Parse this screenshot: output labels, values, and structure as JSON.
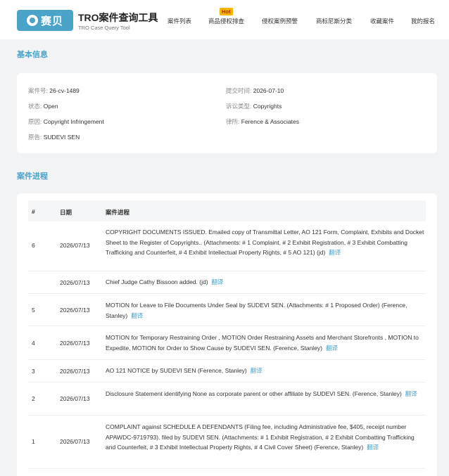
{
  "header": {
    "logo_text": "赛贝",
    "app_title": "TRO案件查询工具",
    "app_subtitle": "TRO Case Query Tool",
    "hot_badge": "Hot",
    "nav": [
      {
        "label": "案件列表"
      },
      {
        "label": "商品侵权排查"
      },
      {
        "label": "侵权案例预警"
      },
      {
        "label": "商标尼斯分类"
      },
      {
        "label": "收藏案件"
      },
      {
        "label": "我的报名"
      }
    ]
  },
  "basic_info": {
    "title": "基本信息",
    "fields": [
      {
        "label": "案件号:",
        "value": "26-cv-1489"
      },
      {
        "label": "提交时间:",
        "value": "2026-07-10"
      },
      {
        "label": "状态:",
        "value": "Open"
      },
      {
        "label": "诉讼类型:",
        "value": "Copyrights"
      },
      {
        "label": "原因:",
        "value": "Copyright Infringement"
      },
      {
        "label": "律所:",
        "value": "Ference & Associates"
      },
      {
        "label": "原告:",
        "value": "SUDEVI SEN"
      }
    ]
  },
  "progress": {
    "title": "案件进程",
    "columns": [
      "#",
      "日期",
      "案件进程"
    ],
    "translate_label": "翻译",
    "rows": [
      {
        "num": "6",
        "date": "2026/07/13",
        "text": "COPYRIGHT DOCUMENTS ISSUED. Emailed copy of Transmittal Letter, AO 121 Form, Complaint, Exhibits and Docket Sheet to the Register of Copyrights.. (Attachments: # 1 Complaint, # 2 Exhibit Registration, # 3 Exhibit Combatting Trafficking and Counterfeit, # 4 Exhibit Intellectual Property Rights, # 5 AO 121) (jd)"
      },
      {
        "num": "",
        "date": "2026/07/13",
        "text": "Chief Judge Cathy Bissoon added. (jd)"
      },
      {
        "num": "5",
        "date": "2026/07/13",
        "text": "MOTION for Leave to File Documents Under Seal by SUDEVI SEN. (Attachments: # 1 Proposed Order) (Ference, Stanley)"
      },
      {
        "num": "4",
        "date": "2026/07/13",
        "text": "MOTION for Temporary Restraining Order , MOTION Order Restraining Assets and Merchant Storefronts , MOTION to Expedite, MOTION for Order to Show Cause by SUDEVI SEN. (Ference, Stanley)"
      },
      {
        "num": "3",
        "date": "2026/07/13",
        "text": "AO 121 NOTICE by SUDEVI SEN (Ference, Stanley)"
      },
      {
        "num": "2",
        "date": "2026/07/13",
        "text": "Disclosure Statement identifying None as corporate parent or other affiliate by SUDEVI SEN. (Ference, Stanley)"
      },
      {
        "num": "1",
        "date": "2026/07/13",
        "text": "COMPLAINT against SCHEDULE A DEFENDANTS (Filing fee, including Administrative fee, $405, receipt number APAWDC-9719793). filed by SUDEVI SEN. (Attachments: # 1 Exhibit Registration, # 2 Exhibit Combatting Trafficking and Counterfeit, # 3 Exhibit Intellectual Property Rights, # 4 Civil Cover Sheet) (Ference, Stanley)"
      }
    ]
  },
  "colors": {
    "accent": "#4aa3c8",
    "hot": "#f5b400",
    "background": "#f2f3f5"
  }
}
